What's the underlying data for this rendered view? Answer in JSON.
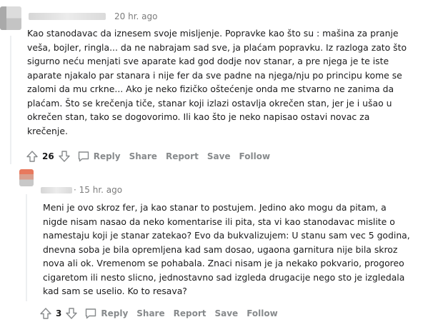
{
  "comments": [
    {
      "timestamp": "20 hr. ago",
      "lines": [
        "Kao stanodavac da iznesem svoje misljenje. Popravke kao što su : mašina za pranje",
        "veša, bojler, ringla... da ne nabrajam sad sve, ja plaćam popravku. Iz razloga zato što",
        "sigurno neću menjati sve aparate kad god dodje nov stanar, a pre njega je te iste",
        "aparate njakalo par stanara i nije fer da sve padne na njega/nju po principu kome se",
        "zalomi da mu crkne... Ako je neko fizičko oštećenje onda me stvarno ne zanima da",
        "plaćam. Što se krečenja tiče, stanar koji izlazi ostavlja okrečen stan, jer je i ušao u",
        "okrečen stan, tako se dogovorimo. Ili kao što je neko napisao ostavi novac za",
        "krečenje."
      ],
      "score": "26",
      "actions": {
        "reply": "Reply",
        "share": "Share",
        "report": "Report",
        "save": "Save",
        "follow": "Follow"
      }
    },
    {
      "timestamp": "· 15 hr. ago",
      "lines": [
        "Meni je ovo skroz fer, ja kao stanar to postujem. Jedino ako mogu da pitam, a",
        "nigde nisam nasao da neko komentarise ili pita, sta vi kao stanodavac mislite o",
        "namestaju koji je stanar zatekao? Evo da bukvalizujem: U stanu sam vec 5 godina,",
        "dnevna soba je bila opremljena kad sam dosao, ugaona garnitura nije bila skroz",
        "nova ali ok. Vremenom se pohabala. Znaci nisam je ja nekako pokvario, progoreo",
        "cigaretom ili nesto slicno, jednostavno sad izgleda drugacije nego sto je izgledala",
        "kad sam se uselio. Ko to resava?"
      ],
      "score": "3",
      "actions": {
        "reply": "Reply",
        "share": "Share",
        "report": "Report",
        "save": "Save",
        "follow": "Follow"
      }
    }
  ],
  "icons": {
    "upvote": "upvote-arrow-icon",
    "downvote": "downvote-arrow-icon",
    "reply": "speech-bubble-icon"
  }
}
